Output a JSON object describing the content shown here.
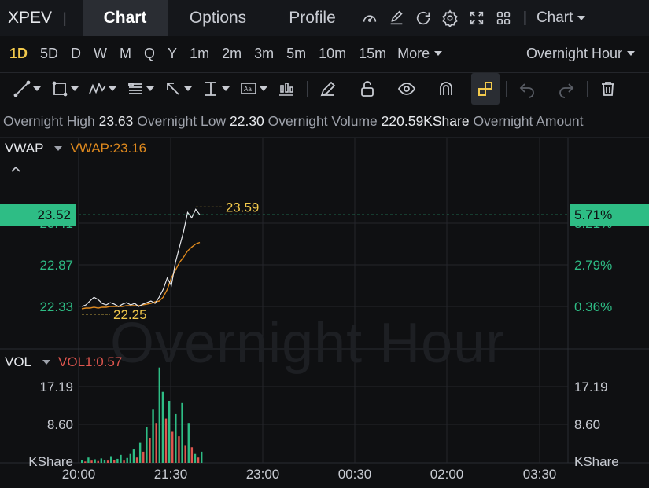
{
  "topbar": {
    "ticker": "XPEV",
    "tabs": [
      {
        "label": "Chart",
        "active": true
      },
      {
        "label": "Options",
        "active": false
      },
      {
        "label": "Profile",
        "active": false
      }
    ],
    "icons": [
      "gauge-icon",
      "edit-icon",
      "refresh-icon",
      "settings-icon",
      "expand-icon",
      "grid-icon"
    ],
    "chart_menu": "Chart"
  },
  "intervals": {
    "items": [
      "1D",
      "5D",
      "D",
      "W",
      "M",
      "Q",
      "Y",
      "1m",
      "2m",
      "3m",
      "5m",
      "10m",
      "15m"
    ],
    "active": "1D",
    "more_label": "More",
    "session_label": "Overnight Hour"
  },
  "toolbar": {
    "tools": [
      "trend-line-icon",
      "rectangle-icon",
      "pattern-icon",
      "fibonacci-icon",
      "arrow-icon",
      "measure-icon",
      "text-note-icon",
      "candle-icon",
      "pencil-icon",
      "unlock-icon",
      "eye-icon",
      "magnet-icon",
      "link-icon",
      "undo-icon",
      "redo-icon",
      "trash-icon"
    ]
  },
  "stats": {
    "high_label": "Overnight High",
    "high": "23.63",
    "low_label": "Overnight Low",
    "low": "22.30",
    "volume_label": "Overnight Volume",
    "volume": "220.59KShare",
    "amount_label": "Overnight Amount"
  },
  "price_panel": {
    "indicator": "VWAP",
    "indicator_value": "VWAP:23.16",
    "watermark": "Overnight Hour",
    "current_price": "23.52",
    "current_pct": "5.71%",
    "left_ticks": [
      "23.41",
      "22.87",
      "22.33"
    ],
    "right_ticks": [
      "3.21%",
      "2.79%",
      "0.36%"
    ],
    "high_marker": "23.59",
    "low_marker": "22.25"
  },
  "volume_panel": {
    "indicator": "VOL",
    "indicator_value": "VOL1:0.57",
    "left_ticks": [
      "17.19",
      "8.60",
      "KShare"
    ],
    "right_ticks": [
      "17.19",
      "8.60",
      "KShare"
    ]
  },
  "time_axis": [
    "20:00",
    "21:30",
    "23:00",
    "00:30",
    "02:00",
    "03:30"
  ],
  "colors": {
    "up": "#2ebd85",
    "down": "#e0564f",
    "accent": "#f2c94c",
    "vwap": "#e08a1e",
    "price_line": "#e6e8ec",
    "background": "#0f1012"
  },
  "chart_data": {
    "type": "line",
    "series": [
      {
        "name": "VWAP",
        "values": [
          22.3,
          22.31,
          22.31,
          22.32,
          22.31,
          22.32,
          22.32,
          22.33,
          22.33,
          22.33,
          22.33,
          22.34,
          22.34,
          22.34,
          22.34,
          22.35,
          22.36,
          22.37,
          22.39,
          22.4,
          22.45,
          22.55,
          22.7,
          22.8,
          22.9,
          22.97,
          23.05,
          23.1,
          23.14,
          23.16
        ]
      },
      {
        "name": "Price",
        "values": [
          22.33,
          22.35,
          22.4,
          22.45,
          22.42,
          22.37,
          22.35,
          22.38,
          22.36,
          22.33,
          22.36,
          22.38,
          22.35,
          22.37,
          22.33,
          22.36,
          22.38,
          22.4,
          22.37,
          22.45,
          22.55,
          22.7,
          22.6,
          22.9,
          23.1,
          23.3,
          23.55,
          23.48,
          23.59,
          23.52
        ]
      }
    ],
    "volume": {
      "values": [
        0.6,
        0.3,
        1.2,
        0.5,
        0.8,
        0.4,
        1.0,
        0.7,
        0.5,
        1.5,
        0.6,
        0.9,
        1.8,
        0.5,
        1.1,
        2.0,
        3.0,
        1.2,
        4.5,
        2.5,
        8.0,
        5.5,
        12.0,
        9.0,
        21.5,
        16.0,
        10.0,
        14.0,
        7.0,
        11.0,
        6.0,
        13.5,
        4.0,
        9.0,
        3.5,
        2.0,
        1.2,
        2.5
      ],
      "up": [
        true,
        false,
        true,
        false,
        true,
        false,
        true,
        true,
        false,
        true,
        false,
        true,
        true,
        false,
        true,
        true,
        true,
        false,
        true,
        false,
        true,
        false,
        true,
        false,
        true,
        true,
        false,
        true,
        false,
        true,
        false,
        true,
        false,
        true,
        false,
        true,
        false,
        true
      ]
    },
    "time_range": [
      "20:00",
      "04:00"
    ]
  }
}
